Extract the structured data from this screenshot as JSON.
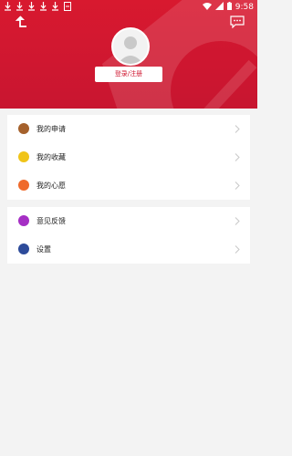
{
  "status_bar": {
    "time": "9:58"
  },
  "header": {
    "login_label": "登录/注册"
  },
  "menu_group_1": [
    {
      "label": "我的申请",
      "icon": "application-icon",
      "color": "#a5612c"
    },
    {
      "label": "我的收藏",
      "icon": "star-icon",
      "color": "#f0c419"
    },
    {
      "label": "我的心愿",
      "icon": "wish-icon",
      "color": "#ef6a2c"
    }
  ],
  "menu_group_2": [
    {
      "label": "意见反馈",
      "icon": "flag-icon",
      "color": "#a52fc4"
    },
    {
      "label": "设置",
      "icon": "settings-icon",
      "color": "#2d4b9a"
    }
  ],
  "colors": {
    "header_red": "#d8192f",
    "background": "#f3f3f3"
  }
}
